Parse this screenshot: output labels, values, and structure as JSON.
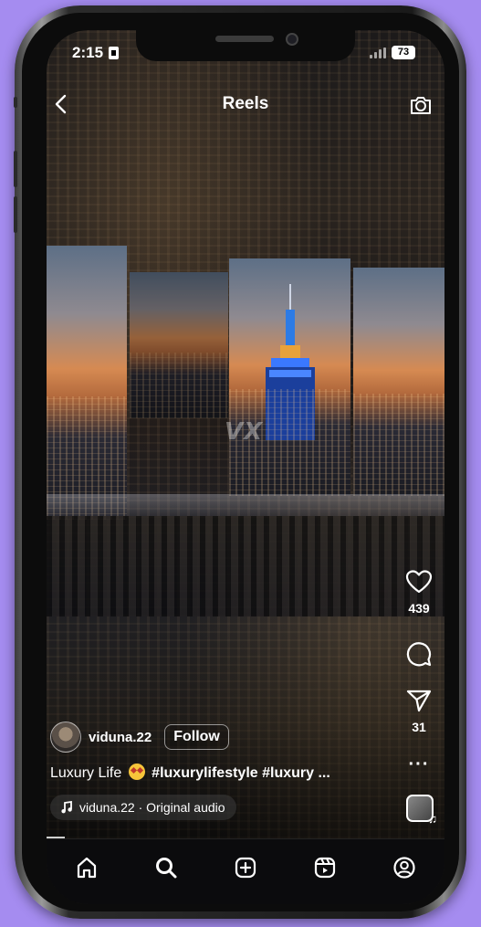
{
  "status_bar": {
    "time": "2:15",
    "battery": "73"
  },
  "header": {
    "title": "Reels",
    "back_icon": "chevron-left-icon",
    "camera_icon": "camera-icon"
  },
  "actions": {
    "like_count": "439",
    "share_count": "31"
  },
  "post": {
    "username": "viduna.22",
    "follow_label": "Follow",
    "caption_text": "Luxury Life",
    "caption_tags": "#luxurylifestyle #luxury ...",
    "audio_label": "viduna.22 · Original audio"
  },
  "video": {
    "watermark": "VX"
  },
  "nav": {
    "items": [
      "home-icon",
      "search-icon",
      "create-icon",
      "reels-icon",
      "profile-icon"
    ]
  }
}
